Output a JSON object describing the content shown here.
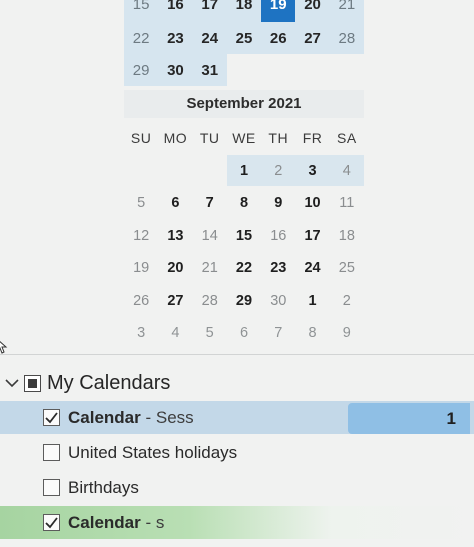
{
  "august": {
    "weeks": [
      [
        {
          "label": "15",
          "style": "dim"
        },
        {
          "label": "16",
          "style": "bold"
        },
        {
          "label": "17",
          "style": "bold"
        },
        {
          "label": "18",
          "style": "bold"
        },
        {
          "label": "19",
          "style": "today"
        },
        {
          "label": "20",
          "style": "bold"
        },
        {
          "label": "21",
          "style": "dim"
        }
      ],
      [
        {
          "label": "22",
          "style": "dim"
        },
        {
          "label": "23",
          "style": "bold"
        },
        {
          "label": "24",
          "style": "bold"
        },
        {
          "label": "25",
          "style": "bold"
        },
        {
          "label": "26",
          "style": "bold"
        },
        {
          "label": "27",
          "style": "bold"
        },
        {
          "label": "28",
          "style": "dim"
        }
      ],
      [
        {
          "label": "29",
          "style": "dim"
        },
        {
          "label": "30",
          "style": "bold"
        },
        {
          "label": "31",
          "style": "bold"
        },
        {
          "label": "",
          "style": "empty"
        },
        {
          "label": "",
          "style": "empty"
        },
        {
          "label": "",
          "style": "empty"
        },
        {
          "label": "",
          "style": "empty"
        }
      ]
    ]
  },
  "september": {
    "title": "September 2021",
    "weekdays": [
      "SU",
      "MO",
      "TU",
      "WE",
      "TH",
      "FR",
      "SA"
    ],
    "weeks": [
      [
        {
          "label": "",
          "style": ""
        },
        {
          "label": "",
          "style": ""
        },
        {
          "label": "",
          "style": ""
        },
        {
          "label": "1",
          "style": "bold highlight"
        },
        {
          "label": "2",
          "style": "highlight"
        },
        {
          "label": "3",
          "style": "bold highlight"
        },
        {
          "label": "4",
          "style": "highlight"
        }
      ],
      [
        {
          "label": "5",
          "style": ""
        },
        {
          "label": "6",
          "style": "bold"
        },
        {
          "label": "7",
          "style": "bold"
        },
        {
          "label": "8",
          "style": "bold"
        },
        {
          "label": "9",
          "style": "bold"
        },
        {
          "label": "10",
          "style": "bold"
        },
        {
          "label": "11",
          "style": ""
        }
      ],
      [
        {
          "label": "12",
          "style": ""
        },
        {
          "label": "13",
          "style": "bold"
        },
        {
          "label": "14",
          "style": ""
        },
        {
          "label": "15",
          "style": "bold"
        },
        {
          "label": "16",
          "style": ""
        },
        {
          "label": "17",
          "style": "bold"
        },
        {
          "label": "18",
          "style": ""
        }
      ],
      [
        {
          "label": "19",
          "style": ""
        },
        {
          "label": "20",
          "style": "bold"
        },
        {
          "label": "21",
          "style": ""
        },
        {
          "label": "22",
          "style": "bold"
        },
        {
          "label": "23",
          "style": "bold"
        },
        {
          "label": "24",
          "style": "bold"
        },
        {
          "label": "25",
          "style": ""
        }
      ],
      [
        {
          "label": "26",
          "style": ""
        },
        {
          "label": "27",
          "style": "bold"
        },
        {
          "label": "28",
          "style": ""
        },
        {
          "label": "29",
          "style": "bold"
        },
        {
          "label": "30",
          "style": ""
        },
        {
          "label": "1",
          "style": "bold"
        },
        {
          "label": "2",
          "style": ""
        }
      ],
      [
        {
          "label": "3",
          "style": "outside"
        },
        {
          "label": "4",
          "style": "outside"
        },
        {
          "label": "5",
          "style": "outside"
        },
        {
          "label": "6",
          "style": "outside"
        },
        {
          "label": "7",
          "style": "outside"
        },
        {
          "label": "8",
          "style": "outside"
        },
        {
          "label": "9",
          "style": "outside"
        }
      ]
    ]
  },
  "calendars": {
    "group_label": "My Calendars",
    "items": [
      {
        "name": "Calendar",
        "owner": " - Sess",
        "checked": true,
        "count": "1"
      },
      {
        "name": "United States holidays",
        "owner": "",
        "checked": false,
        "count": ""
      },
      {
        "name": "Birthdays",
        "owner": "",
        "checked": false,
        "count": ""
      },
      {
        "name": "Calendar",
        "owner": " - s",
        "checked": true,
        "count": ""
      }
    ]
  },
  "colors": {
    "today": "#1e73c2",
    "selected_row": "#c3d8e8",
    "count_badge": "#8fbfe5",
    "green_row": "#a6d4a1"
  }
}
